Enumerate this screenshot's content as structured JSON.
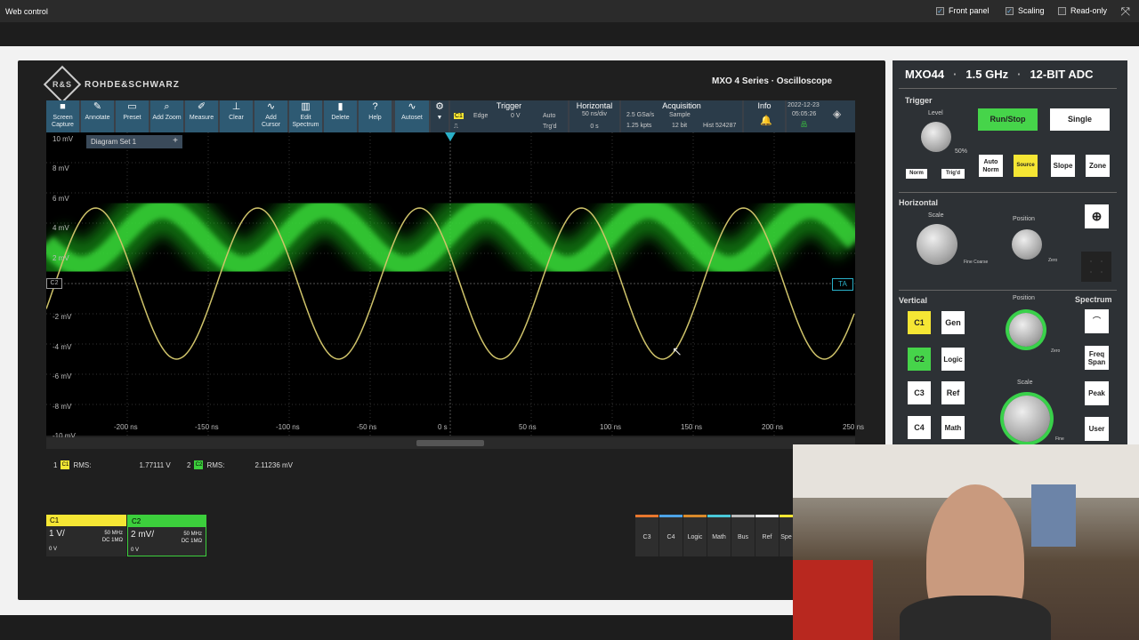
{
  "window": {
    "title": "Web control",
    "opts": [
      "Front panel",
      "Scaling",
      "Read-only"
    ],
    "checked": [
      true,
      true,
      false
    ]
  },
  "brand": {
    "logo": "R&S",
    "name": "ROHDE&SCHWARZ",
    "series": "MXO 4 Series · Oscilloscope"
  },
  "toolbar": {
    "tools": [
      {
        "l1": "Screen",
        "l2": "Capture",
        "icon": "camera-icon"
      },
      {
        "l1": "Annotate",
        "l2": "",
        "icon": "pen-icon"
      },
      {
        "l1": "Preset",
        "l2": "",
        "icon": "preset-icon"
      },
      {
        "l1": "Add Zoom",
        "l2": "",
        "icon": "zoom-icon"
      },
      {
        "l1": "Measure",
        "l2": "",
        "icon": "measure-icon"
      },
      {
        "l1": "Clear",
        "l2": "",
        "icon": "clear-icon"
      },
      {
        "l1": "Add",
        "l2": "Cursor",
        "icon": "cursor-icon"
      },
      {
        "l1": "Edit",
        "l2": "Spectrum",
        "icon": "spectrum-icon"
      },
      {
        "l1": "Delete",
        "l2": "",
        "icon": "trash-icon"
      },
      {
        "l1": "Help",
        "l2": "",
        "icon": "help-icon"
      },
      {
        "l1": "Autoset",
        "l2": "",
        "icon": "autoset-icon"
      }
    ],
    "trigger": {
      "title": "Trigger",
      "src": "C1",
      "type": "Edge",
      "level": "0 V",
      "mode": "Auto",
      "state": "Trg'd"
    },
    "horizontal": {
      "title": "Horizontal",
      "scale": "50 ns/div",
      "pos": "0 s"
    },
    "acquisition": {
      "title": "Acquisition",
      "rate": "2.5 GSa/s",
      "mode": "Sample",
      "pts": "1.25 kpts",
      "bits": "12 bit",
      "hist": "Hist 524287"
    },
    "info": {
      "title": "Info"
    },
    "datetime": {
      "date": "2022-12-23",
      "time": "05:05:26"
    }
  },
  "diagram": {
    "set_label": "Diagram Set 1",
    "add": "+",
    "yticks": [
      "10 mV",
      "8 mV",
      "6 mV",
      "4 mV",
      "2 mV",
      "",
      "-2 mV",
      "-4 mV",
      "-6 mV",
      "-8 mV",
      "-10 mV"
    ],
    "xticks": [
      "-200 ns",
      "-150 ns",
      "-100 ns",
      "-50 ns",
      "0 s",
      "50 ns",
      "100 ns",
      "150 ns",
      "200 ns",
      "250 ns"
    ],
    "c2_marker": "C2",
    "ta_marker": "TA"
  },
  "measurements": [
    {
      "idx": "1",
      "ch": "C1",
      "name": "RMS:",
      "value": "1.77111 V",
      "color": "#f5e634"
    },
    {
      "idx": "2",
      "ch": "C2",
      "name": "RMS:",
      "value": "2.11236 mV",
      "color": "#3ccf3c"
    }
  ],
  "channels": [
    {
      "name": "C1",
      "scale": "1 V/",
      "bw": "50 MHz",
      "coupling": "DC 1MΩ",
      "offset": "0 V",
      "color": "#f5e634"
    },
    {
      "name": "C2",
      "scale": "2 mV/",
      "bw": "50 MHz",
      "coupling": "DC 1MΩ",
      "offset": "0 V",
      "color": "#3ccf3c"
    }
  ],
  "bottom_tabs": [
    {
      "label": "C3",
      "color": "#e8772e"
    },
    {
      "label": "C4",
      "color": "#4da3e6"
    },
    {
      "label": "Logic",
      "color": "#d98a2b"
    },
    {
      "label": "Math",
      "color": "#49c8d8"
    },
    {
      "label": "Bus",
      "color": "#bbbbbb"
    },
    {
      "label": "Ref",
      "color": "#eeeeee"
    },
    {
      "label": "Spe",
      "color": "#f5e634"
    }
  ],
  "panel": {
    "model": "MXO44",
    "bw": "1.5 GHz",
    "adc": "12-BIT ADC",
    "trigger": "Trigger",
    "level": "Level",
    "pct": "50%",
    "norm": "Norm",
    "trigd": "Trig'd",
    "runstop": "Run/Stop",
    "single": "Single",
    "autonorm": "Auto Norm",
    "source": "Source",
    "slope": "Slope",
    "zone": "Zone",
    "horizontal": "Horizontal",
    "scale": "Scale",
    "position": "Position",
    "fine": "Fine Coarse",
    "zero": "Zero",
    "vertical": "Vertical",
    "spectrum": "Spectrum",
    "vpos": "Position",
    "vscale": "Scale",
    "c1": "C1",
    "gen": "Gen",
    "c2": "C2",
    "logic": "Logic",
    "c3": "C3",
    "ref": "Ref",
    "c4": "C4",
    "math": "Math",
    "freqspan": "Freq Span",
    "peak": "Peak",
    "user": "User",
    "fine2": "Fine"
  }
}
